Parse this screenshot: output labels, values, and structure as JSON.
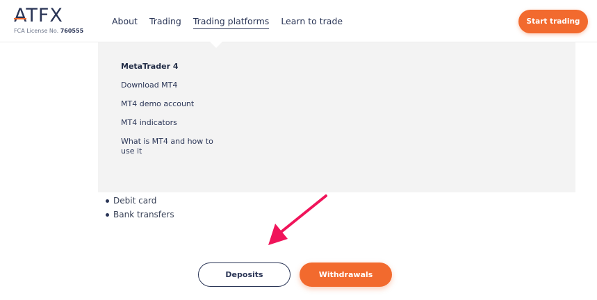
{
  "brand": {
    "logo_text": "ATFX",
    "license_label": "FCA License No.",
    "license_number": "760555",
    "accent_color": "#f26a2e",
    "navy_color": "#2a3556"
  },
  "nav": {
    "items": [
      {
        "label": "About"
      },
      {
        "label": "Trading"
      },
      {
        "label": "Trading platforms",
        "active": true
      },
      {
        "label": "Learn to trade"
      }
    ],
    "cta_label": "Start trading"
  },
  "dropdown": {
    "title": "MetaTrader 4",
    "items": [
      {
        "label": "Download MT4"
      },
      {
        "label": "MT4 demo account"
      },
      {
        "label": "MT4 indicators"
      },
      {
        "label": "What is MT4 and how to use it"
      }
    ]
  },
  "content": {
    "bullets": [
      "Debit card",
      "Bank transfers"
    ],
    "buttons": {
      "deposits": "Deposits",
      "withdrawals": "Withdrawals"
    }
  },
  "annotation": {
    "icon": "arrow-icon",
    "color": "#f0145a"
  }
}
